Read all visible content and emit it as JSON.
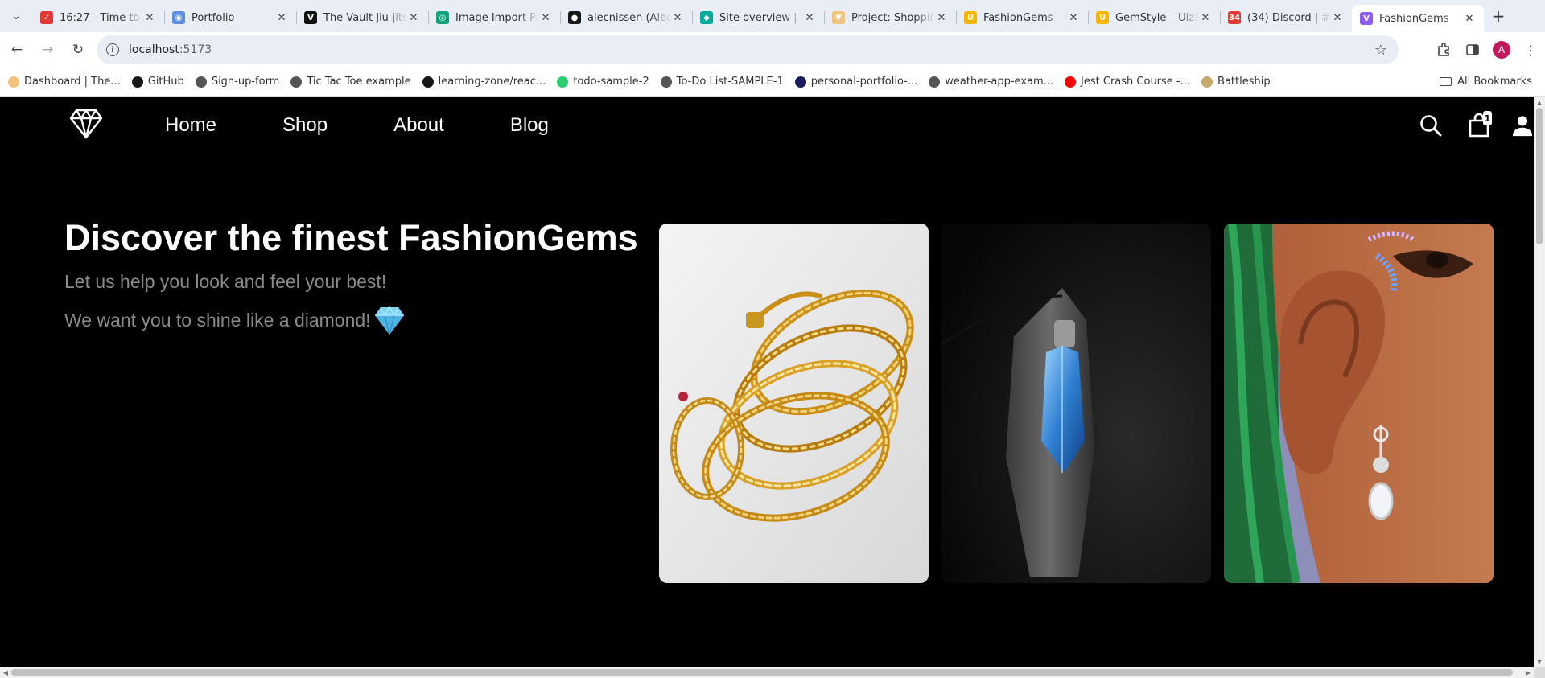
{
  "browser": {
    "tabs": [
      {
        "title": "16:27 - Time to f",
        "favicon_color": "#e53935",
        "favicon_glyph": "✓"
      },
      {
        "title": "Portfolio",
        "favicon_color": "#5c8ee6",
        "favicon_glyph": "◉"
      },
      {
        "title": "The Vault Jiu-jitsu",
        "favicon_color": "#111111",
        "favicon_glyph": "V"
      },
      {
        "title": "Image Import Pa",
        "favicon_color": "#10a37f",
        "favicon_glyph": "◎"
      },
      {
        "title": "alecnissen (Alec",
        "favicon_color": "#181717",
        "favicon_glyph": "●"
      },
      {
        "title": "Site overview | s",
        "favicon_color": "#00ad9f",
        "favicon_glyph": "◆"
      },
      {
        "title": "Project: Shopping",
        "favicon_color": "#f2c37a",
        "favicon_glyph": "▼"
      },
      {
        "title": "FashionGems – U",
        "favicon_color": "#f7b500",
        "favicon_glyph": "U"
      },
      {
        "title": "GemStyle – Uiza",
        "favicon_color": "#f7b500",
        "favicon_glyph": "U"
      },
      {
        "title": "(34) Discord | #",
        "favicon_color": "#e53935",
        "favicon_glyph": "34"
      },
      {
        "title": "FashionGems",
        "favicon_color": "#8e5cf7",
        "favicon_glyph": "V"
      }
    ],
    "active_tab_index": 10,
    "url_host": "localhost",
    "url_port": ":5173",
    "profile_initial": "A",
    "bookmarks": [
      {
        "label": "Dashboard | The...",
        "color": "#f2c37a"
      },
      {
        "label": "GitHub",
        "color": "#181717"
      },
      {
        "label": "Sign-up-form",
        "color": "#555555"
      },
      {
        "label": "Tic Tac Toe example",
        "color": "#555555"
      },
      {
        "label": "learning-zone/reac...",
        "color": "#181717"
      },
      {
        "label": "todo-sample-2",
        "color": "#2ecc71"
      },
      {
        "label": "To-Do List-SAMPLE-1",
        "color": "#555555"
      },
      {
        "label": "personal-portfolio-...",
        "color": "#1c1c5c"
      },
      {
        "label": "weather-app-exam...",
        "color": "#555555"
      },
      {
        "label": "Jest Crash Course -...",
        "color": "#ff0000"
      },
      {
        "label": "Battleship",
        "color": "#c9a96a"
      }
    ],
    "all_bookmarks_label": "All Bookmarks"
  },
  "site": {
    "nav": [
      "Home",
      "Shop",
      "About",
      "Blog"
    ],
    "cart_count": "1",
    "hero": {
      "title": "Discover the finest FashionGems",
      "subtitle_1": "Let us help you look and feel your best!",
      "subtitle_2": "We want you to shine like a diamond!"
    }
  },
  "colors": {
    "background": "#000000",
    "text_primary": "#ffffff",
    "text_secondary": "#8a8a8a"
  }
}
